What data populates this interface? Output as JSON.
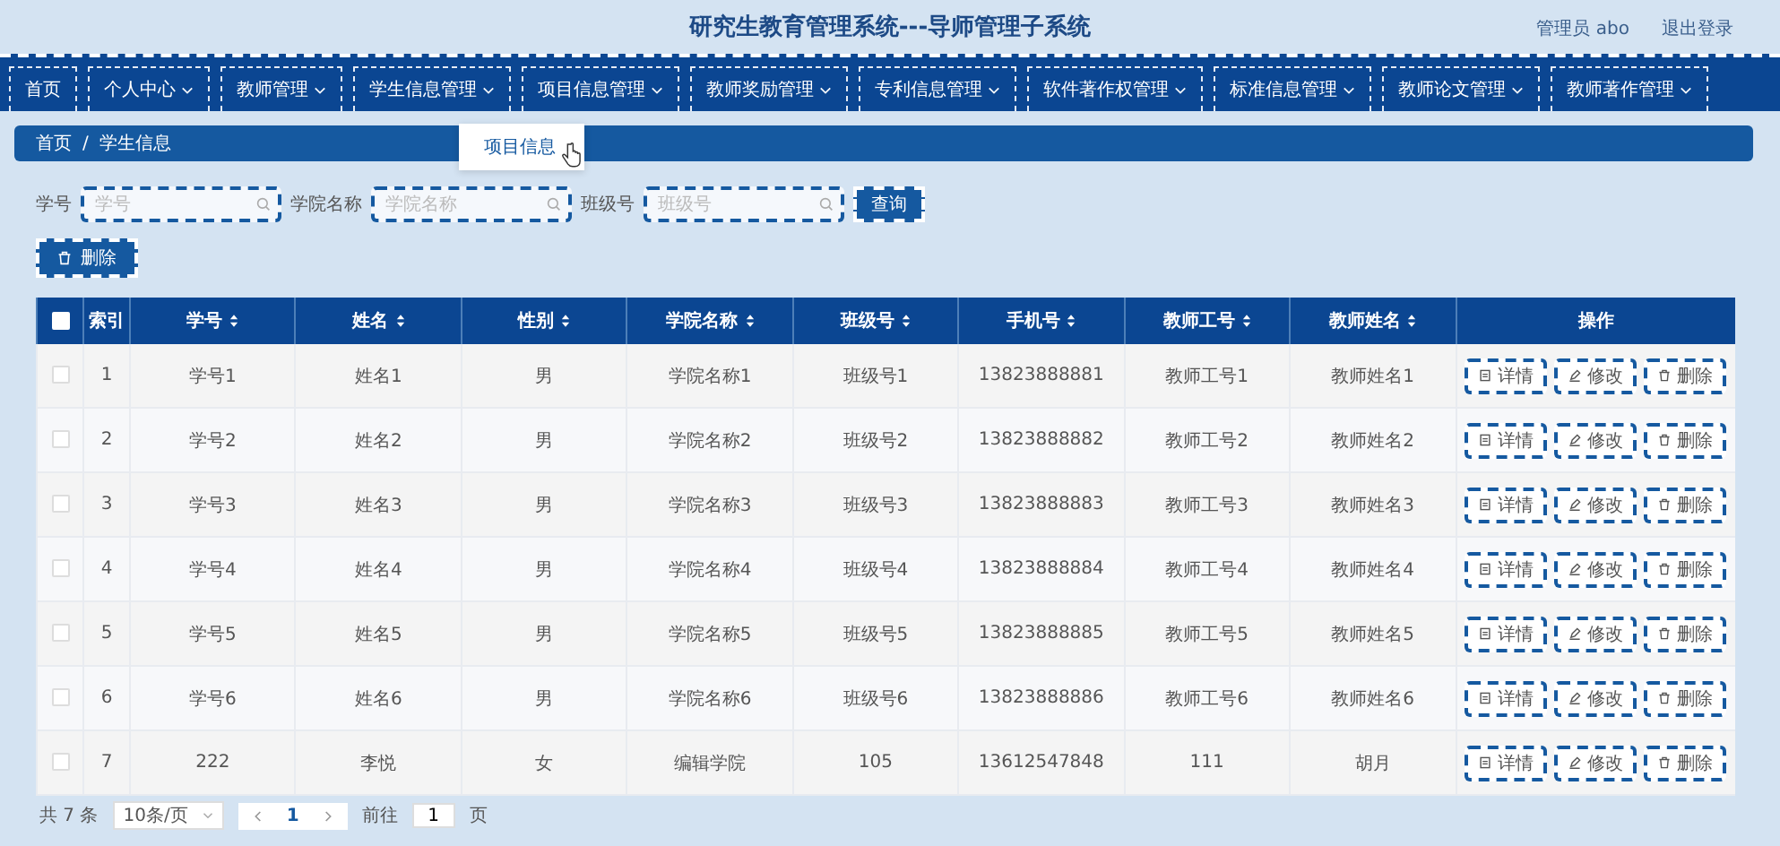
{
  "header": {
    "title": "研究生教育管理系统---导师管理子系统",
    "user": "管理员 abo",
    "logout": "退出登录"
  },
  "nav": [
    {
      "label": "首页",
      "dropdown": false
    },
    {
      "label": "个人中心",
      "dropdown": true
    },
    {
      "label": "教师管理",
      "dropdown": true
    },
    {
      "label": "学生信息管理",
      "dropdown": true
    },
    {
      "label": "项目信息管理",
      "dropdown": true
    },
    {
      "label": "教师奖励管理",
      "dropdown": true
    },
    {
      "label": "专利信息管理",
      "dropdown": true
    },
    {
      "label": "软件著作权管理",
      "dropdown": true
    },
    {
      "label": "标准信息管理",
      "dropdown": true
    },
    {
      "label": "教师论文管理",
      "dropdown": true
    },
    {
      "label": "教师著作管理",
      "dropdown": true
    }
  ],
  "dropdown_menu": {
    "item": "项目信息"
  },
  "breadcrumb": {
    "items": [
      "首页",
      "学生信息"
    ],
    "separator": "/"
  },
  "search": {
    "fields": [
      {
        "label": "学号",
        "placeholder": "学号"
      },
      {
        "label": "学院名称",
        "placeholder": "学院名称"
      },
      {
        "label": "班级号",
        "placeholder": "班级号"
      }
    ],
    "button": "查询"
  },
  "delete_button": "删除",
  "table": {
    "select_all": {
      "checked": false
    },
    "columns": [
      {
        "label": "索引",
        "sortable": false
      },
      {
        "label": "学号",
        "sortable": true
      },
      {
        "label": "姓名",
        "sortable": true
      },
      {
        "label": "性别",
        "sortable": true
      },
      {
        "label": "学院名称",
        "sortable": true
      },
      {
        "label": "班级号",
        "sortable": true
      },
      {
        "label": "手机号",
        "sortable": true
      },
      {
        "label": "教师工号",
        "sortable": true
      },
      {
        "label": "教师姓名",
        "sortable": true
      },
      {
        "label": "操作",
        "sortable": false
      }
    ],
    "rows": [
      {
        "checked": false,
        "cells": [
          "1",
          "学号1",
          "姓名1",
          "男",
          "学院名称1",
          "班级号1",
          "13823888881",
          "教师工号1",
          "教师姓名1"
        ],
        "actions": [
          "详情",
          "修改",
          "删除"
        ]
      },
      {
        "checked": false,
        "cells": [
          "2",
          "学号2",
          "姓名2",
          "男",
          "学院名称2",
          "班级号2",
          "13823888882",
          "教师工号2",
          "教师姓名2"
        ],
        "actions": [
          "详情",
          "修改",
          "删除"
        ]
      },
      {
        "checked": false,
        "cells": [
          "3",
          "学号3",
          "姓名3",
          "男",
          "学院名称3",
          "班级号3",
          "13823888883",
          "教师工号3",
          "教师姓名3"
        ],
        "actions": [
          "详情",
          "修改",
          "删除"
        ]
      },
      {
        "checked": false,
        "cells": [
          "4",
          "学号4",
          "姓名4",
          "男",
          "学院名称4",
          "班级号4",
          "13823888884",
          "教师工号4",
          "教师姓名4"
        ],
        "actions": [
          "详情",
          "修改",
          "删除"
        ]
      },
      {
        "checked": false,
        "cells": [
          "5",
          "学号5",
          "姓名5",
          "男",
          "学院名称5",
          "班级号5",
          "13823888885",
          "教师工号5",
          "教师姓名5"
        ],
        "actions": [
          "详情",
          "修改",
          "删除"
        ]
      },
      {
        "checked": false,
        "cells": [
          "6",
          "学号6",
          "姓名6",
          "男",
          "学院名称6",
          "班级号6",
          "13823888886",
          "教师工号6",
          "教师姓名6"
        ],
        "actions": [
          "详情",
          "修改",
          "删除"
        ]
      },
      {
        "checked": false,
        "cells": [
          "7",
          "222",
          "李悦",
          "女",
          "编辑学院",
          "105",
          "13612547848",
          "111",
          "胡月"
        ],
        "actions": [
          "详情",
          "修改",
          "删除"
        ]
      }
    ]
  },
  "pagination": {
    "total": "共 7 条",
    "page_size": "10条/页",
    "pages": [
      {
        "label": "1",
        "selected": true
      }
    ],
    "goto_label": "前往",
    "goto_value": "1",
    "goto_suffix": "页"
  }
}
